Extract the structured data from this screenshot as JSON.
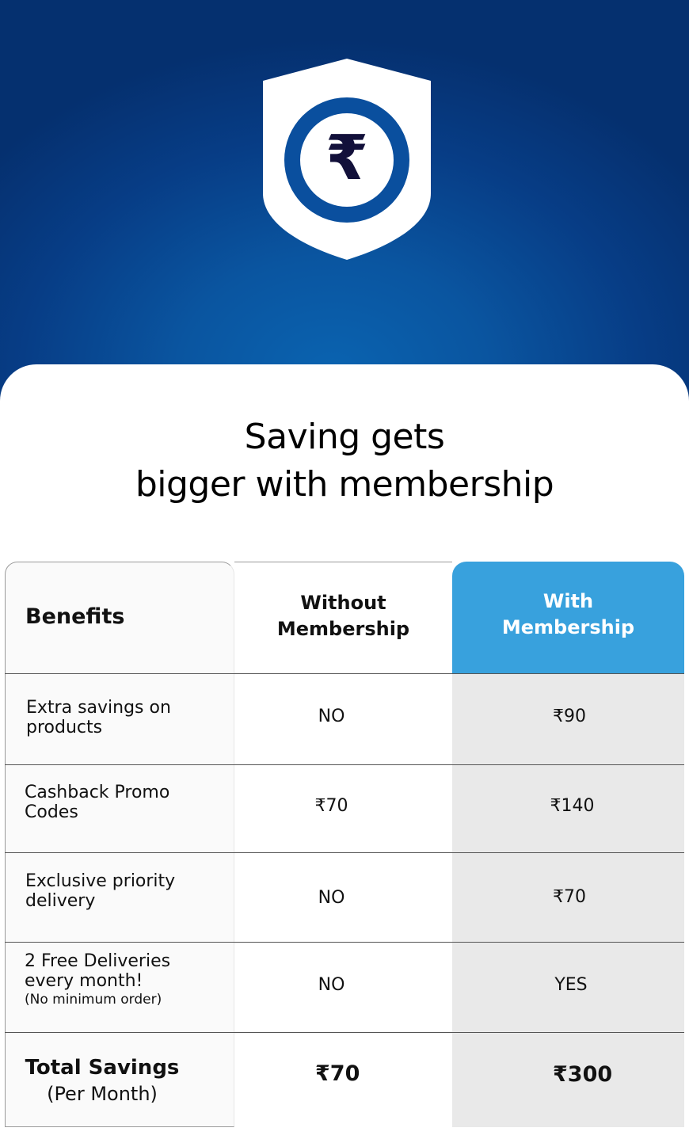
{
  "colors": {
    "hero_dark": "#05306f",
    "hero_light": "#0a63b0",
    "accent": "#38a1dd",
    "with_column": "#e9e9e9"
  },
  "hero": {
    "icon": "rupee-shield-icon",
    "currency_symbol": "₹"
  },
  "headline": {
    "line1": "Saving gets",
    "line2": "bigger with membership"
  },
  "table": {
    "headers": {
      "benefits": "Benefits",
      "without_line1": "Without",
      "without_line2": "Membership",
      "with_line1": "With",
      "with_line2": "Membership"
    },
    "rows": [
      {
        "line1": "Extra savings on",
        "line2": "products",
        "without": "NO",
        "with": "₹90"
      },
      {
        "line1": "Cashback Promo",
        "line2": "Codes",
        "without": "₹70",
        "with": "₹140"
      },
      {
        "line1": "Exclusive priority",
        "line2": "delivery",
        "without": "NO",
        "with": "₹70"
      },
      {
        "line1": "2 Free Deliveries",
        "line2": "every month!",
        "note": "(No minimum order)",
        "without": "NO",
        "with": "YES"
      }
    ],
    "total": {
      "label": "Total Savings",
      "sublabel": "(Per Month)",
      "without": "₹70",
      "with": "₹300"
    }
  }
}
